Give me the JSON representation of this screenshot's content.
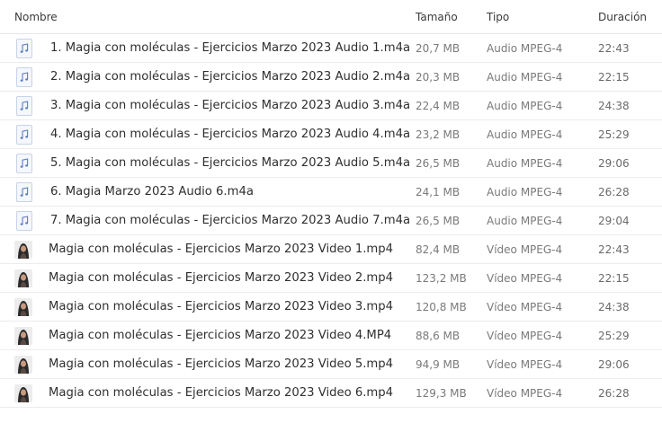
{
  "header": {
    "name": "Nombre",
    "size": "Tamaño",
    "type": "Tipo",
    "duration": "Duración"
  },
  "files": [
    {
      "name": "1. Magia con moléculas - Ejercicios Marzo 2023 Audio 1.m4a",
      "size": "20,7 MB",
      "type": "Audio MPEG-4",
      "duration": "22:43",
      "icon": "audio-file-icon"
    },
    {
      "name": "2. Magia con moléculas - Ejercicios Marzo 2023 Audio 2.m4a",
      "size": "20,3 MB",
      "type": "Audio MPEG-4",
      "duration": "22:15",
      "icon": "audio-file-icon"
    },
    {
      "name": "3. Magia con moléculas - Ejercicios Marzo 2023 Audio 3.m4a",
      "size": "22,4 MB",
      "type": "Audio MPEG-4",
      "duration": "24:38",
      "icon": "audio-file-icon"
    },
    {
      "name": "4. Magia con moléculas - Ejercicios Marzo 2023 Audio 4.m4a",
      "size": "23,2 MB",
      "type": "Audio MPEG-4",
      "duration": "25:29",
      "icon": "audio-file-icon"
    },
    {
      "name": "5. Magia con moléculas - Ejercicios Marzo 2023 Audio 5.m4a",
      "size": "26,5 MB",
      "type": "Audio MPEG-4",
      "duration": "29:06",
      "icon": "audio-file-icon"
    },
    {
      "name": "6. Magia Marzo 2023 Audio 6.m4a",
      "size": "24,1 MB",
      "type": "Audio MPEG-4",
      "duration": "26:28",
      "icon": "audio-file-icon"
    },
    {
      "name": "7. Magia con moléculas - Ejercicios Marzo 2023 Audio 7.m4a",
      "size": "26,5 MB",
      "type": "Audio MPEG-4",
      "duration": "29:04",
      "icon": "audio-file-icon"
    },
    {
      "name": "Magia con moléculas - Ejercicios Marzo 2023 Video 1.mp4",
      "size": "82,4 MB",
      "type": "Vídeo MPEG-4",
      "duration": "22:43",
      "icon": "video-thumbnail-icon"
    },
    {
      "name": "Magia con moléculas - Ejercicios Marzo 2023 Video 2.mp4",
      "size": "123,2 MB",
      "type": "Vídeo MPEG-4",
      "duration": "22:15",
      "icon": "video-thumbnail-icon"
    },
    {
      "name": "Magia con moléculas - Ejercicios Marzo 2023 Video 3.mp4",
      "size": "120,8 MB",
      "type": "Vídeo MPEG-4",
      "duration": "24:38",
      "icon": "video-thumbnail-icon"
    },
    {
      "name": "Magia con moléculas - Ejercicios Marzo 2023 Video 4.MP4",
      "size": "88,6 MB",
      "type": "Vídeo MPEG-4",
      "duration": "25:29",
      "icon": "video-thumbnail-icon"
    },
    {
      "name": "Magia con moléculas - Ejercicios Marzo 2023 Video 5.mp4",
      "size": "94,9 MB",
      "type": "Vídeo MPEG-4",
      "duration": "29:06",
      "icon": "video-thumbnail-icon"
    },
    {
      "name": "Magia con moléculas - Ejercicios Marzo 2023 Video 6.mp4",
      "size": "129,3 MB",
      "type": "Vídeo MPEG-4",
      "duration": "26:28",
      "icon": "video-thumbnail-icon"
    }
  ],
  "colors": {
    "audio_icon_border": "#c8d3e6",
    "audio_icon_note": "#5b7fc4",
    "row_divider": "#ececec"
  }
}
